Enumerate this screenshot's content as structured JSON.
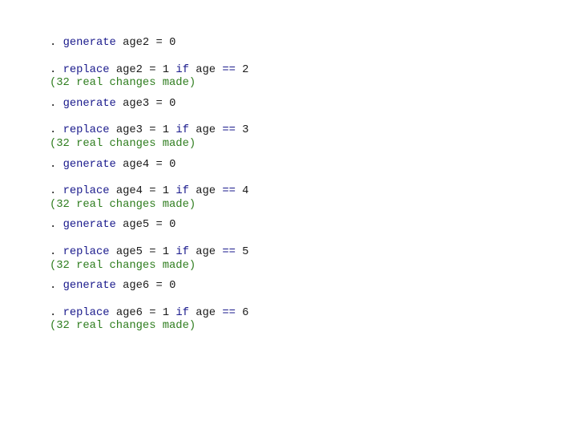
{
  "console": {
    "colors": {
      "keyword": "#1a1a8c",
      "text": "#1a1a1a",
      "output": "#2e7d1e",
      "background": "#ffffff"
    },
    "entries": [
      {
        "generate": {
          "prompt": ". ",
          "cmd": "generate",
          "var": "age2",
          "assign": "=",
          "value": "0"
        },
        "replace": {
          "prompt": ". ",
          "cmd": "replace",
          "var": "age2",
          "assign": "=",
          "value": "1",
          "if": "if",
          "cond_var": "age",
          "op": "==",
          "cond_val": "2"
        },
        "output": "(32 real changes made)"
      },
      {
        "generate": {
          "prompt": ". ",
          "cmd": "generate",
          "var": "age3",
          "assign": "=",
          "value": "0"
        },
        "replace": {
          "prompt": ". ",
          "cmd": "replace",
          "var": "age3",
          "assign": "=",
          "value": "1",
          "if": "if",
          "cond_var": "age",
          "op": "==",
          "cond_val": "3"
        },
        "output": "(32 real changes made)"
      },
      {
        "generate": {
          "prompt": ". ",
          "cmd": "generate",
          "var": "age4",
          "assign": "=",
          "value": "0"
        },
        "replace": {
          "prompt": ". ",
          "cmd": "replace",
          "var": "age4",
          "assign": "=",
          "value": "1",
          "if": "if",
          "cond_var": "age",
          "op": "==",
          "cond_val": "4"
        },
        "output": "(32 real changes made)"
      },
      {
        "generate": {
          "prompt": ". ",
          "cmd": "generate",
          "var": "age5",
          "assign": "=",
          "value": "0"
        },
        "replace": {
          "prompt": ". ",
          "cmd": "replace",
          "var": "age5",
          "assign": "=",
          "value": "1",
          "if": "if",
          "cond_var": "age",
          "op": "==",
          "cond_val": "5"
        },
        "output": "(32 real changes made)"
      },
      {
        "generate": {
          "prompt": ". ",
          "cmd": "generate",
          "var": "age6",
          "assign": "=",
          "value": "0"
        },
        "replace": {
          "prompt": ". ",
          "cmd": "replace",
          "var": "age6",
          "assign": "=",
          "value": "1",
          "if": "if",
          "cond_var": "age",
          "op": "==",
          "cond_val": "6"
        },
        "output": "(32 real changes made)"
      }
    ]
  }
}
